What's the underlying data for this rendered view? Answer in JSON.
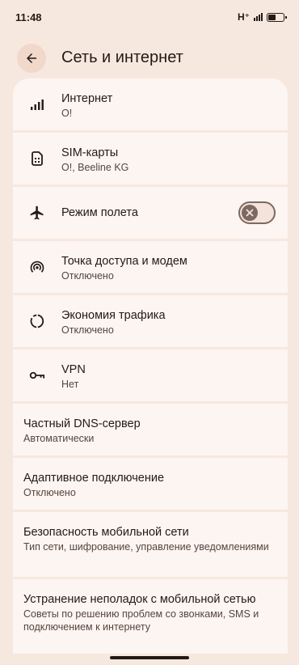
{
  "status": {
    "time": "11:48",
    "network": "H⁺"
  },
  "header": {
    "title": "Сеть и интернет"
  },
  "items": [
    {
      "title": "Интернет",
      "subtitle": "O!",
      "icon": "signal-icon"
    },
    {
      "title": "SIM-карты",
      "subtitle": "O!, Beeline KG",
      "icon": "sim-card-icon"
    },
    {
      "title": "Режим полета",
      "icon": "airplane-icon",
      "toggle_on": false
    },
    {
      "title": "Точка доступа и модем",
      "subtitle": "Отключено",
      "icon": "hotspot-icon"
    },
    {
      "title": "Экономия трафика",
      "subtitle": "Отключено",
      "icon": "data-saver-icon"
    },
    {
      "title": "VPN",
      "subtitle": "Нет",
      "icon": "vpn-key-icon"
    },
    {
      "title": "Частный DNS-сервер",
      "subtitle": "Автоматически"
    },
    {
      "title": "Адаптивное подключение",
      "subtitle": "Отключено"
    },
    {
      "title": "Безопасность мобильной сети",
      "subtitle": "Тип сети, шифрование, управление уведомлениями"
    },
    {
      "title": "Устранение неполадок с мобильной сетью",
      "subtitle": "Советы по решению проблем со звонками, SMS и подключением к интернету"
    }
  ],
  "colors": {
    "background": "#f7e8df",
    "card": "#fdf5f1",
    "toggle_off": "#7c6a62"
  }
}
